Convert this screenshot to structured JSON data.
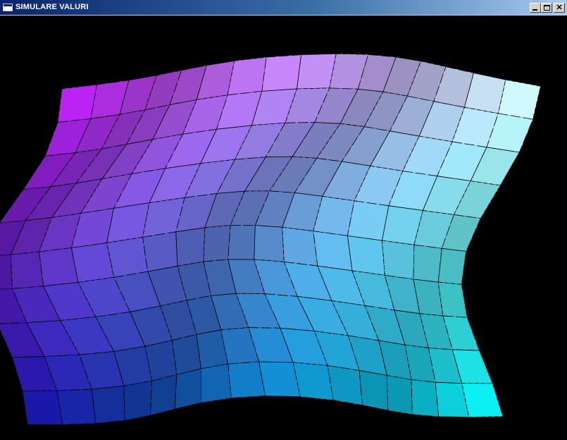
{
  "window": {
    "title": "SIMULARE VALURI",
    "controls": {
      "minimize": "minimize-icon",
      "maximize": "maximize-icon",
      "close": "close-icon"
    }
  },
  "scene": {
    "background": "#000000",
    "mesh": {
      "columns": 16,
      "rows": 10,
      "color_top_left": "#c81eff",
      "color_top_right": "#dcffff",
      "color_bottom_left": "#1010a0",
      "color_bottom_right": "#00ffff",
      "wireframe_color": "#000000"
    }
  }
}
